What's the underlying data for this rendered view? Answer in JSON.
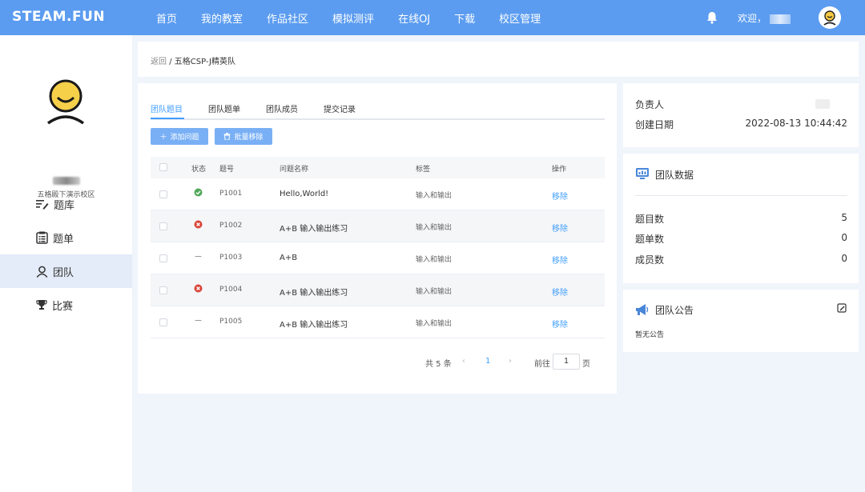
{
  "brand": "STEAM.FUN",
  "nav": [
    "首页",
    "我的教室",
    "作品社区",
    "模拟测评",
    "在线OJ",
    "下载",
    "校区管理"
  ],
  "welcome": "欢迎，",
  "sidebar": {
    "school": "五格殿下演示校区",
    "items": [
      {
        "label": "题库",
        "icon": "list-edit-icon"
      },
      {
        "label": "题单",
        "icon": "clipboard-list-icon"
      },
      {
        "label": "团队",
        "icon": "user-icon"
      },
      {
        "label": "比赛",
        "icon": "trophy-icon"
      }
    ],
    "active_index": 2
  },
  "breadcrumb": {
    "back": "返回",
    "sep": "/",
    "current": "五格CSP-J精英队"
  },
  "tabs": [
    "团队题目",
    "团队题单",
    "团队成员",
    "提交记录"
  ],
  "active_tab": 0,
  "buttons": {
    "add": "添加问题",
    "batch_remove": "批量移除"
  },
  "table": {
    "headers": [
      "状态",
      "题号",
      "问题名称",
      "标签",
      "操作"
    ],
    "rows": [
      {
        "status": "accepted",
        "id": "P1001",
        "name": "Hello,World!",
        "tag": "输入和输出",
        "op": "移除"
      },
      {
        "status": "wrong",
        "id": "P1002",
        "name": "A+B 输入输出练习",
        "tag": "输入和输出",
        "op": "移除"
      },
      {
        "status": "none",
        "id": "P1003",
        "name": "A+B",
        "tag": "输入和输出",
        "op": "移除"
      },
      {
        "status": "wrong",
        "id": "P1004",
        "name": "A+B 输入输出练习",
        "tag": "输入和输出",
        "op": "移除"
      },
      {
        "status": "none",
        "id": "P1005",
        "name": "A+B 输入输出练习",
        "tag": "输入和输出",
        "op": "移除"
      }
    ]
  },
  "pager": {
    "total": "共 5 条",
    "current": "1",
    "goto": "前往",
    "page_value": "1",
    "page_suffix": "页"
  },
  "info": {
    "owner_label": "负责人",
    "date_label": "创建日期",
    "date_value": "2022-08-13 10:44:42"
  },
  "stats": {
    "title": "团队数据",
    "items": [
      {
        "label": "题目数",
        "value": "5"
      },
      {
        "label": "题单数",
        "value": "0"
      },
      {
        "label": "成员数",
        "value": "0"
      }
    ]
  },
  "notice": {
    "title": "团队公告",
    "content": "暂无公告"
  },
  "colors": {
    "primary": "#5b9cf0",
    "link": "#409eff",
    "accepted": "#52a85a",
    "wrong": "#d9463a"
  }
}
